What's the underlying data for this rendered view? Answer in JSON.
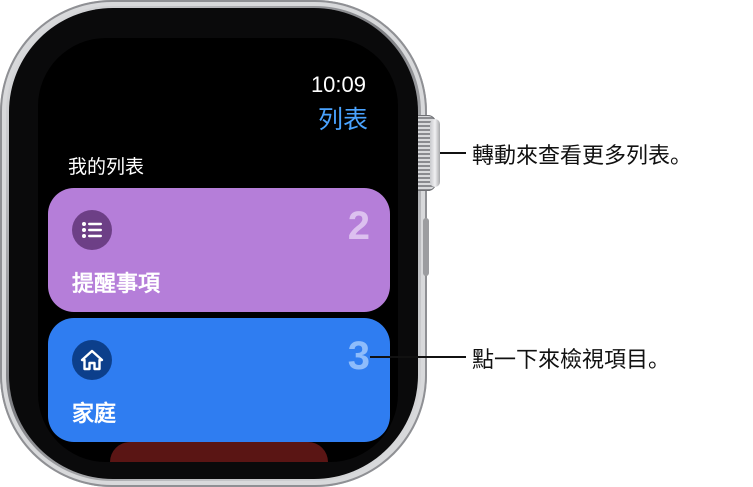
{
  "watch": {
    "time": "10:09",
    "nav_title": "列表",
    "section_label": "我的列表",
    "lists": [
      {
        "name": "提醒事項",
        "count": "2",
        "icon": "list-icon",
        "color": "#b57ed9"
      },
      {
        "name": "家庭",
        "count": "3",
        "icon": "house-icon",
        "color": "#2f7df1"
      }
    ]
  },
  "callouts": {
    "crown": "轉動來查看更多列表。",
    "list": "點一下來檢視項目。"
  }
}
